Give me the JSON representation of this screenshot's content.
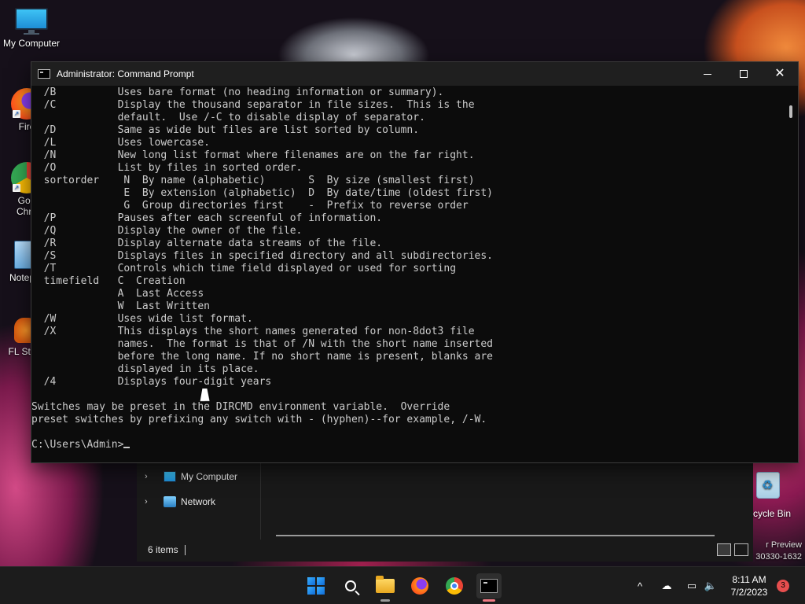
{
  "desktop": {
    "icons": [
      {
        "label": "My Computer"
      },
      {
        "label": "Fire"
      },
      {
        "label": "Goo"
      },
      {
        "label": "Chro"
      },
      {
        "label": "Notep"
      },
      {
        "label": "FL Stu"
      }
    ],
    "recycle_bin": {
      "label": "cycle Bin"
    },
    "watermark": {
      "line1": "r Preview",
      "line2": "30330-1632"
    }
  },
  "explorer": {
    "nav_items": [
      {
        "label": "My Computer",
        "icon": "monitor-icon"
      },
      {
        "label": "Network",
        "icon": "network-icon"
      }
    ],
    "status": {
      "items_count": "6 items"
    }
  },
  "cmd": {
    "title": "Administrator: Command Prompt",
    "output": "  /B          Uses bare format (no heading information or summary).\n  /C          Display the thousand separator in file sizes.  This is the\n              default.  Use /-C to disable display of separator.\n  /D          Same as wide but files are list sorted by column.\n  /L          Uses lowercase.\n  /N          New long list format where filenames are on the far right.\n  /O          List by files in sorted order.\n  sortorder    N  By name (alphabetic)       S  By size (smallest first)\n               E  By extension (alphabetic)  D  By date/time (oldest first)\n               G  Group directories first    -  Prefix to reverse order\n  /P          Pauses after each screenful of information.\n  /Q          Display the owner of the file.\n  /R          Display alternate data streams of the file.\n  /S          Displays files in specified directory and all subdirectories.\n  /T          Controls which time field displayed or used for sorting\n  timefield   C  Creation\n              A  Last Access\n              W  Last Written\n  /W          Uses wide list format.\n  /X          This displays the short names generated for non-8dot3 file\n              names.  The format is that of /N with the short name inserted\n              before the long name. If no short name is present, blanks are\n              displayed in its place.\n  /4          Displays four-digit years\n\nSwitches may be preset in the DIRCMD environment variable.  Override\npreset switches by prefixing any switch with - (hyphen)--for example, /-W.\n\nC:\\Users\\Admin>",
    "prompt": "C:\\Users\\Admin>"
  },
  "taskbar": {
    "apps": [
      {
        "name": "start",
        "icon": "windows-logo-icon"
      },
      {
        "name": "search",
        "icon": "search-icon"
      },
      {
        "name": "file-explorer",
        "icon": "folder-icon"
      },
      {
        "name": "firefox",
        "icon": "firefox-icon"
      },
      {
        "name": "chrome",
        "icon": "chrome-icon"
      },
      {
        "name": "command-prompt",
        "icon": "terminal-icon",
        "active": true
      }
    ],
    "tray": {
      "chevron": "^",
      "time": "8:11 AM",
      "date": "7/2/2023",
      "notification_count": "3"
    }
  },
  "colors": {
    "console_bg": "#0c0c0c",
    "console_fg": "#cccccc",
    "titlebar_bg": "#1f1f1f",
    "taskbar_bg": "#1c1c1c",
    "active_indicator": "#f07a84"
  }
}
